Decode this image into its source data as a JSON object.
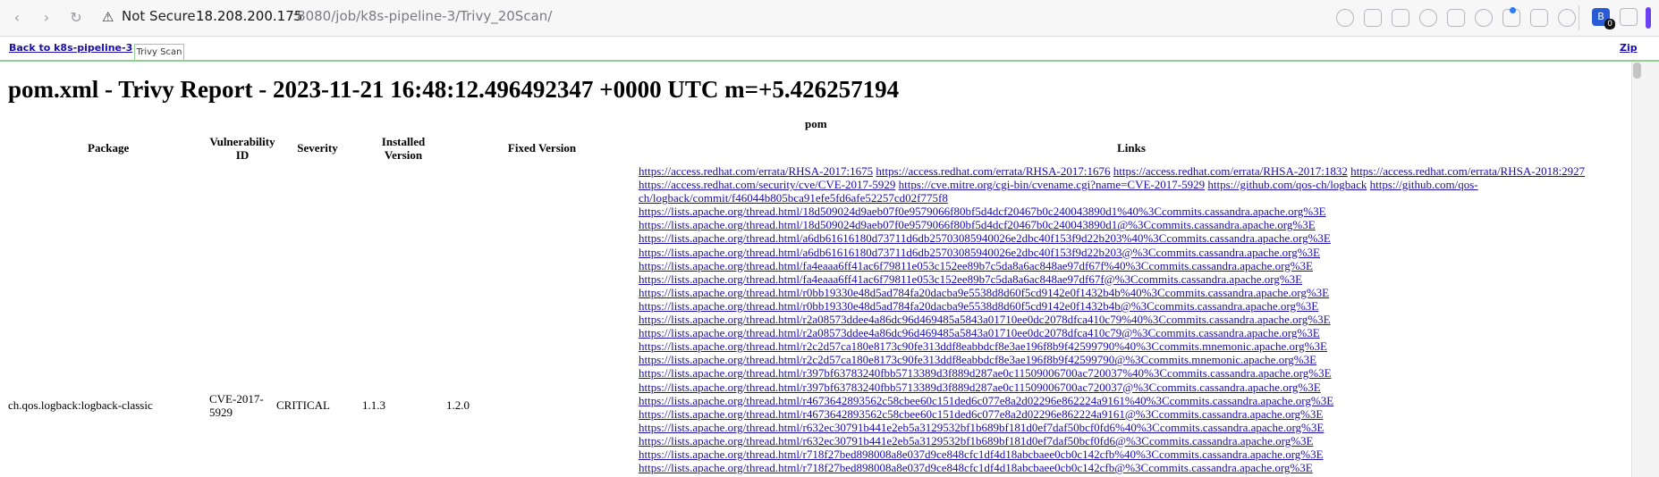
{
  "browser": {
    "security_label": "Not Secure",
    "url_host": "18.208.200.175",
    "url_path": ":8080/job/k8s-pipeline-3/Trivy_20Scan/",
    "extension_badge": "0"
  },
  "tabs": {
    "back_label": "Back to k8s-pipeline-3",
    "active_tab": "Trivy Scan",
    "zip_label": "Zip"
  },
  "report": {
    "title": "pom.xml - Trivy Report - 2023-11-21 16:48:12.496492347 +0000 UTC m=+5.426257194",
    "group_label": "pom",
    "columns": {
      "package": "Package",
      "vuln_id": "Vulnerability ID",
      "severity": "Severity",
      "installed": "Installed Version",
      "fixed": "Fixed Version",
      "links": "Links"
    },
    "row": {
      "package": "ch.qos.logback:logback-classic",
      "vuln_id": "CVE-2017-5929",
      "severity": "CRITICAL",
      "installed": "1.1.3",
      "fixed": "1.2.0"
    },
    "links": [
      "https://access.redhat.com/errata/RHSA-2017:1675",
      "https://access.redhat.com/errata/RHSA-2017:1676",
      "https://access.redhat.com/errata/RHSA-2017:1832",
      "https://access.redhat.com/errata/RHSA-2018:2927",
      "https://access.redhat.com/security/cve/CVE-2017-5929",
      "https://cve.mitre.org/cgi-bin/cvename.cgi?name=CVE-2017-5929",
      "https://github.com/qos-ch/logback",
      "https://github.com/qos-ch/logback/commit/f46044b805bca91efe5fd6afe52257cd02f775f8",
      "https://lists.apache.org/thread.html/18d509024d9aeb07f0e9579066f80bf5d4dcf20467b0c240043890d1%40%3Ccommits.cassandra.apache.org%3E",
      "https://lists.apache.org/thread.html/18d509024d9aeb07f0e9579066f80bf5d4dcf20467b0c240043890d1@%3Ccommits.cassandra.apache.org%3E",
      "https://lists.apache.org/thread.html/a6db61616180d73711d6db25703085940026e2dbc40f153f9d22b203%40%3Ccommits.cassandra.apache.org%3E",
      "https://lists.apache.org/thread.html/a6db61616180d73711d6db25703085940026e2dbc40f153f9d22b203@%3Ccommits.cassandra.apache.org%3E",
      "https://lists.apache.org/thread.html/fa4eaaa6ff41ac6f79811e053c152ee89b7c5da8a6ac848ae97df67f%40%3Ccommits.cassandra.apache.org%3E",
      "https://lists.apache.org/thread.html/fa4eaaa6ff41ac6f79811e053c152ee89b7c5da8a6ac848ae97df67f@%3Ccommits.cassandra.apache.org%3E",
      "https://lists.apache.org/thread.html/r0bb19330e48d5ad784fa20dacba9e5538d8d60f5cd9142e0f1432b4b%40%3Ccommits.cassandra.apache.org%3E",
      "https://lists.apache.org/thread.html/r0bb19330e48d5ad784fa20dacba9e5538d8d60f5cd9142e0f1432b4b@%3Ccommits.cassandra.apache.org%3E",
      "https://lists.apache.org/thread.html/r2a08573ddee4a86dc96d469485a5843a01710ee0dc2078dfca410c79%40%3Ccommits.cassandra.apache.org%3E",
      "https://lists.apache.org/thread.html/r2a08573ddee4a86dc96d469485a5843a01710ee0dc2078dfca410c79@%3Ccommits.cassandra.apache.org%3E",
      "https://lists.apache.org/thread.html/r2c2d57ca180e8173c90fe313ddf8eabbdcf8e3ae196f8b9f42599790%40%3Ccommits.mnemonic.apache.org%3E",
      "https://lists.apache.org/thread.html/r2c2d57ca180e8173c90fe313ddf8eabbdcf8e3ae196f8b9f42599790@%3Ccommits.mnemonic.apache.org%3E",
      "https://lists.apache.org/thread.html/r397bf63783240fbb5713389d3f889d287ae0c11509006700ac720037%40%3Ccommits.cassandra.apache.org%3E",
      "https://lists.apache.org/thread.html/r397bf63783240fbb5713389d3f889d287ae0c11509006700ac720037@%3Ccommits.cassandra.apache.org%3E",
      "https://lists.apache.org/thread.html/r4673642893562c58cbee60c151ded6c077e8a2d02296e862224a9161%40%3Ccommits.cassandra.apache.org%3E",
      "https://lists.apache.org/thread.html/r4673642893562c58cbee60c151ded6c077e8a2d02296e862224a9161@%3Ccommits.cassandra.apache.org%3E",
      "https://lists.apache.org/thread.html/r632ec30791b441e2eb5a3129532bf1b689bf181d0ef7daf50bcf0fd6%40%3Ccommits.cassandra.apache.org%3E",
      "https://lists.apache.org/thread.html/r632ec30791b441e2eb5a3129532bf1b689bf181d0ef7daf50bcf0fd6@%3Ccommits.cassandra.apache.org%3E",
      "https://lists.apache.org/thread.html/r718f27bed898008a8e037d9ce848cfc1df4d18abcbaee0cb0c142cfb%40%3Ccommits.cassandra.apache.org%3E",
      "https://lists.apache.org/thread.html/r718f27bed898008a8e037d9ce848cfc1df4d18abcbaee0cb0c142cfb@%3Ccommits.cassandra.apache.org%3E"
    ]
  }
}
